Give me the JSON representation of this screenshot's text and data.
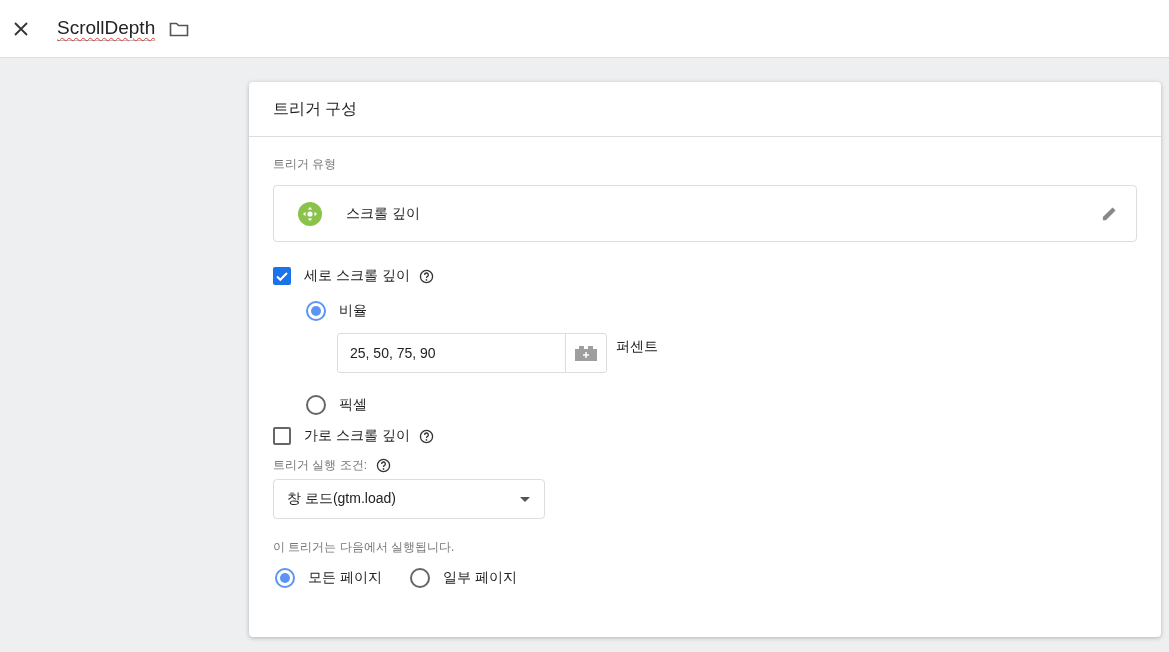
{
  "header": {
    "name": "ScrollDepth"
  },
  "card": {
    "title": "트리거 구성"
  },
  "trigger_type": {
    "label": "트리거 유형",
    "value": "스크롤 깊이"
  },
  "vertical": {
    "label": "세로 스크롤 깊이",
    "checked": true,
    "options": [
      {
        "label": "비율",
        "selected": true,
        "value": "25, 50, 75, 90",
        "unit": "퍼센트"
      },
      {
        "label": "픽셀",
        "selected": false
      }
    ]
  },
  "horizontal": {
    "label": "가로 스크롤 깊이",
    "checked": false
  },
  "fire_on": {
    "label": "트리거 실행 조건:",
    "value": "창 로드(gtm.load)"
  },
  "scope": {
    "label": "이 트리거는 다음에서 실행됩니다.",
    "options": [
      {
        "label": "모든 페이지",
        "selected": true
      },
      {
        "label": "일부 페이지",
        "selected": false
      }
    ]
  }
}
